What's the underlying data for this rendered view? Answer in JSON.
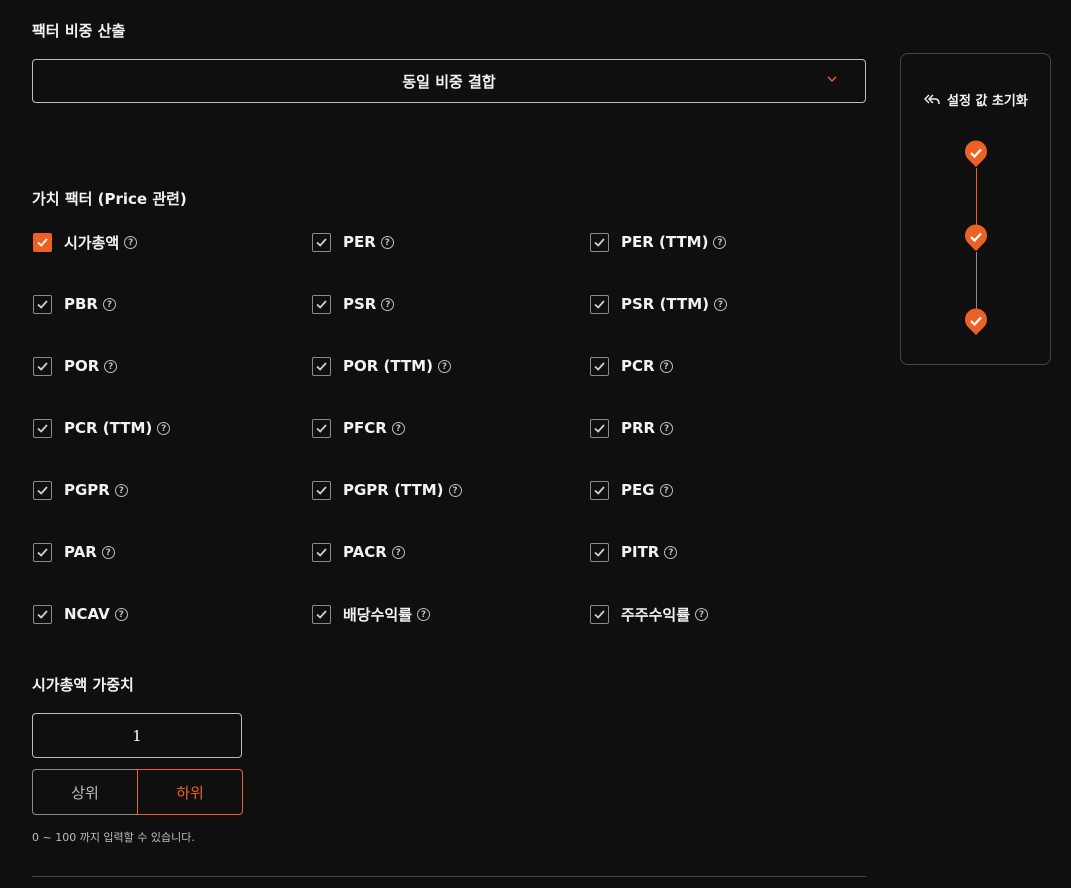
{
  "section_title": "팩터 비중 산출",
  "dropdown": {
    "selected": "동일 비중 결합"
  },
  "group_title": "가치 팩터 (Price 관련)",
  "factors": [
    {
      "label": "시가총액",
      "checked": true,
      "accent": true
    },
    {
      "label": "PER",
      "checked": true
    },
    {
      "label": "PER (TTM)",
      "checked": true
    },
    {
      "label": "PBR",
      "checked": true
    },
    {
      "label": "PSR",
      "checked": true
    },
    {
      "label": "PSR (TTM)",
      "checked": true
    },
    {
      "label": "POR",
      "checked": true
    },
    {
      "label": "POR (TTM)",
      "checked": true
    },
    {
      "label": "PCR",
      "checked": true
    },
    {
      "label": "PCR (TTM)",
      "checked": true
    },
    {
      "label": "PFCR",
      "checked": true
    },
    {
      "label": "PRR",
      "checked": true
    },
    {
      "label": "PGPR",
      "checked": true
    },
    {
      "label": "PGPR (TTM)",
      "checked": true
    },
    {
      "label": "PEG",
      "checked": true
    },
    {
      "label": "PAR",
      "checked": true
    },
    {
      "label": "PACR",
      "checked": true
    },
    {
      "label": "PITR",
      "checked": true
    },
    {
      "label": "NCAV",
      "checked": true
    },
    {
      "label": "배당수익률",
      "checked": true
    },
    {
      "label": "주주수익률",
      "checked": true
    }
  ],
  "weight": {
    "title": "시가총액 가중치",
    "value": "1",
    "upper_label": "상위",
    "lower_label": "하위",
    "selected": "하위",
    "hint": "0 ~ 100 까지 입력할 수 있습니다."
  },
  "side_panel": {
    "reset_label": "설정 값 초기화",
    "steps_completed": 3
  },
  "colors": {
    "accent": "#ec6224",
    "background": "#0f0f0f",
    "border": "#bdbdbd"
  },
  "icons": {
    "help": "question-circle-icon",
    "dropdown": "chevron-down-icon",
    "reset": "reply-all-icon",
    "step": "check-pin-icon"
  }
}
